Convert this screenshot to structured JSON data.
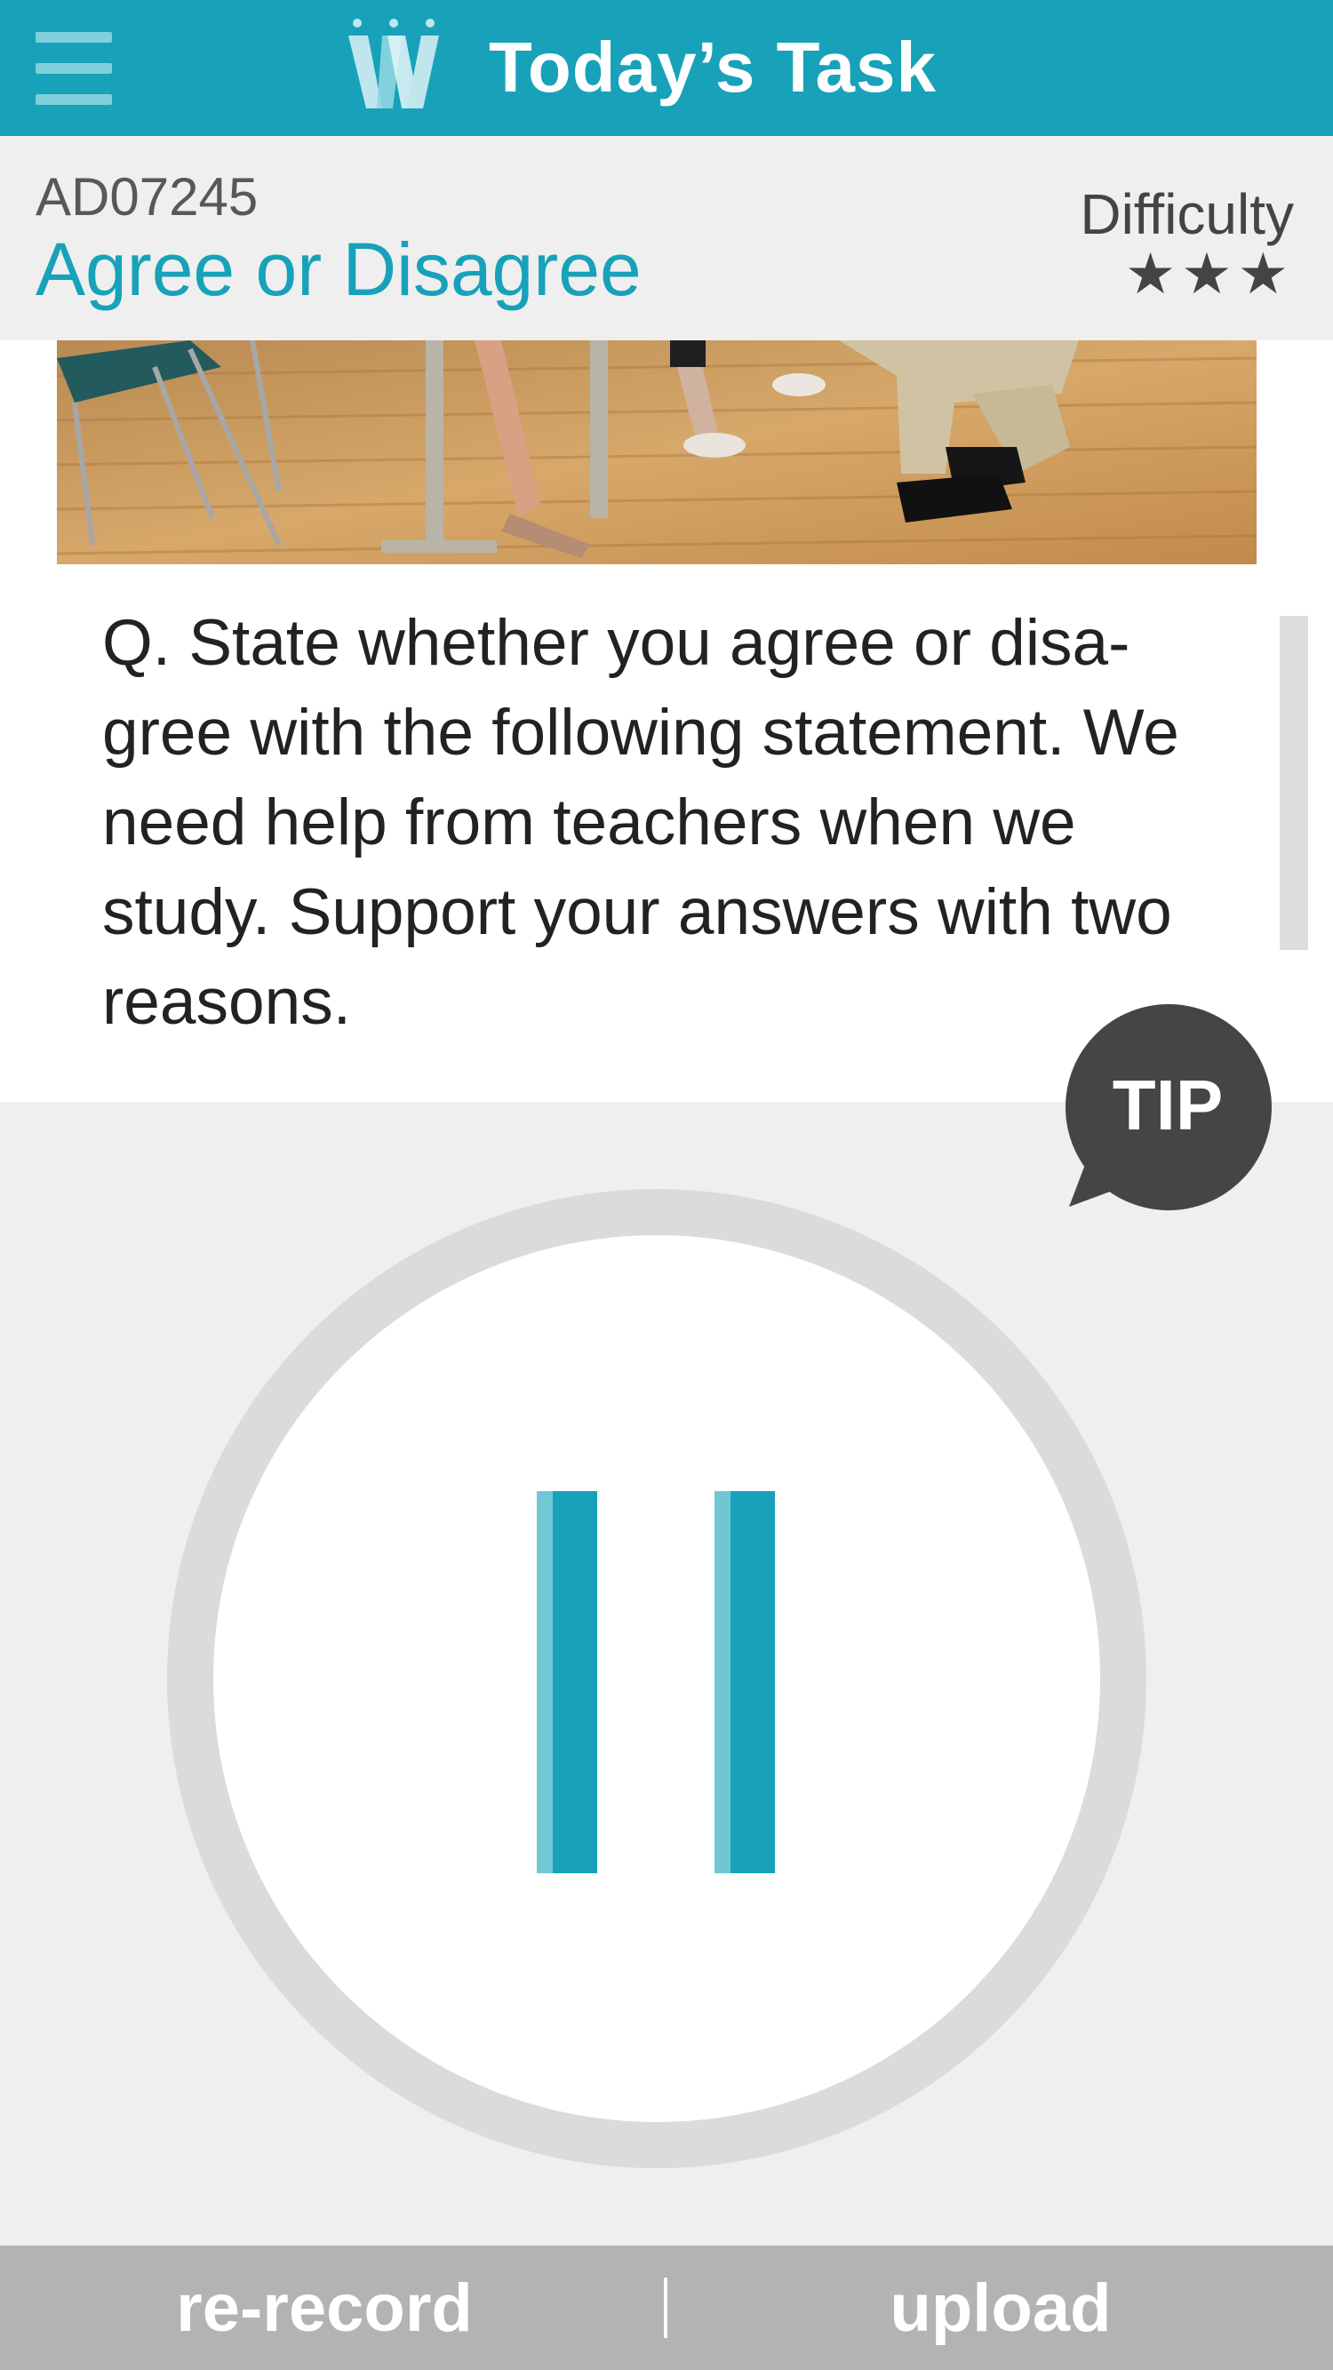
{
  "header": {
    "title": "Today’s Task",
    "brand_color": "#17a2ba",
    "menu_icon": "hamburger-icon",
    "logo_icon": "w-logo-icon"
  },
  "task": {
    "code": "AD07245",
    "title": "Agree or Disagree",
    "difficulty_label": "Difficulty",
    "difficulty_stars": "★★★",
    "difficulty_rating": 3
  },
  "question": {
    "text": "Q. State whether you agree or disa-gree with the following statement. We need help from teachers when we study. Support your answers with two reasons."
  },
  "tip": {
    "label": "TIP",
    "color": "#454548"
  },
  "recorder": {
    "state_icon": "pause-icon",
    "ring_color": "#dadcdc"
  },
  "footer": {
    "rerecord_label": "re-record",
    "upload_label": "upload",
    "background": "#b2b3b3"
  }
}
